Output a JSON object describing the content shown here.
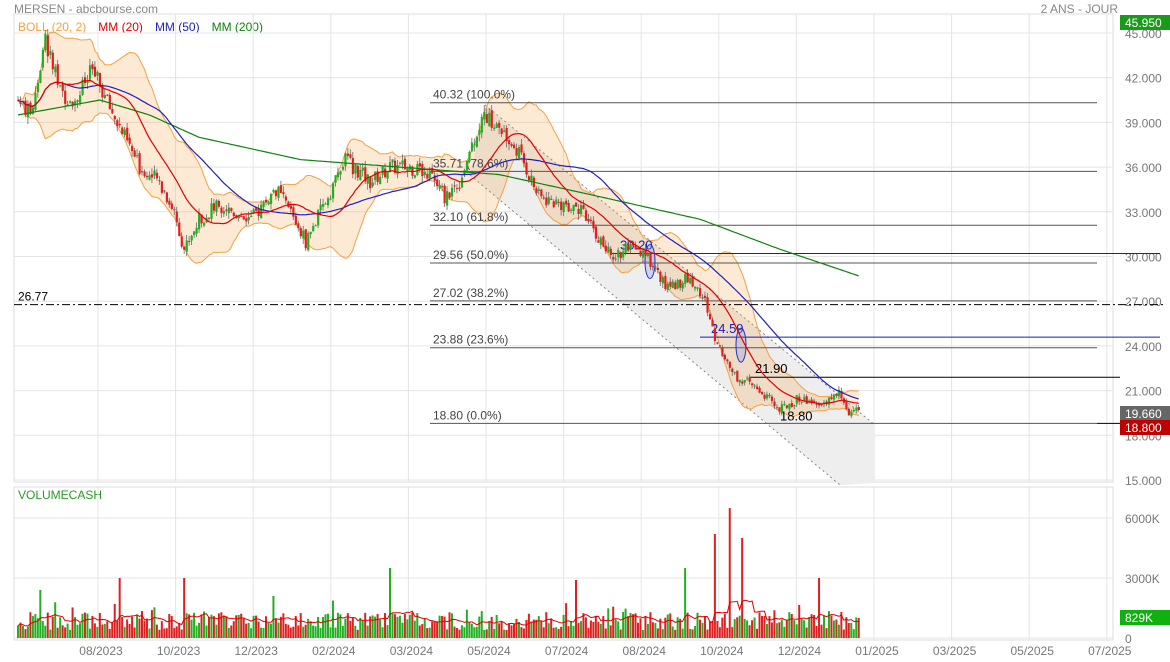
{
  "header": {
    "title": "MERSEN - abcbourse.com",
    "period": "2 ANS - JOUR"
  },
  "legend": [
    {
      "label": "BOLL (20, 2)",
      "color": "#f5a040"
    },
    {
      "label": "MM (20)",
      "color": "#e00000"
    },
    {
      "label": "MM (50)",
      "color": "#2020c0"
    },
    {
      "label": "MM (200)",
      "color": "#108010"
    }
  ],
  "volume_panel": {
    "title": "VOLUMECASH",
    "axis": [
      "6000K",
      "3000K",
      "0"
    ],
    "last_badge": "829K"
  },
  "price_axis": [
    "45.000",
    "42.000",
    "39.000",
    "36.000",
    "33.000",
    "30.000",
    "27.000",
    "24.000",
    "21.000",
    "18.000",
    "15.000"
  ],
  "badges": {
    "high": "45.950",
    "last": "19.660",
    "low": "18.800"
  },
  "x_axis": [
    "08/2023",
    "10/2023",
    "12/2023",
    "02/2024",
    "03/2024",
    "05/2024",
    "07/2024",
    "08/2024",
    "10/2024",
    "12/2024",
    "01/2025",
    "03/2025",
    "05/2025",
    "07/2025"
  ],
  "annotations": {
    "support_line": {
      "value": 26.77,
      "label": "26.77"
    },
    "fibonacci": [
      {
        "price": 40.32,
        "label": "40.32  (100.0%)"
      },
      {
        "price": 35.71,
        "label": "35.71  (78.6%)"
      },
      {
        "price": 32.1,
        "label": "32.10  (61.8%)"
      },
      {
        "price": 29.56,
        "label": "29.56  (50.0%)"
      },
      {
        "price": 27.02,
        "label": "27.02  (38.2%)"
      },
      {
        "price": 23.88,
        "label": "23.88  (23.6%)"
      },
      {
        "price": 18.8,
        "label": "18.80  (0.0%)"
      }
    ],
    "blue_levels": [
      {
        "price": 30.2,
        "label": "30.20"
      },
      {
        "price": 24.59,
        "label": "24.59"
      }
    ],
    "range_high": {
      "price": 21.9,
      "label": "21.90"
    },
    "range_low": {
      "price": 18.8,
      "label": "18.80"
    }
  },
  "chart_data": {
    "type": "candlestick",
    "ylim": [
      15,
      45
    ],
    "close_keypoints": [
      [
        0,
        40.5
      ],
      [
        5,
        39.5
      ],
      [
        11,
        44.5
      ],
      [
        17,
        41
      ],
      [
        23,
        40.5
      ],
      [
        30,
        42.5
      ],
      [
        37,
        40
      ],
      [
        43,
        38
      ],
      [
        49,
        36
      ],
      [
        57,
        35
      ],
      [
        63,
        33
      ],
      [
        67,
        30.5
      ],
      [
        73,
        32.5
      ],
      [
        81,
        33.5
      ],
      [
        94,
        32.5
      ],
      [
        104,
        34.5
      ],
      [
        110,
        33
      ],
      [
        116,
        31
      ],
      [
        122,
        33
      ],
      [
        132,
        36.5
      ],
      [
        142,
        35
      ],
      [
        150,
        36
      ],
      [
        158,
        36
      ],
      [
        166,
        35.5
      ],
      [
        172,
        34
      ],
      [
        178,
        35
      ],
      [
        184,
        38
      ],
      [
        188,
        39.5
      ],
      [
        194,
        38.5
      ],
      [
        202,
        37
      ],
      [
        210,
        34
      ],
      [
        219,
        33.5
      ],
      [
        225,
        33.5
      ],
      [
        231,
        32
      ],
      [
        239,
        30
      ],
      [
        247,
        30.5
      ],
      [
        255,
        29.7
      ],
      [
        261,
        28
      ],
      [
        271,
        28.5
      ],
      [
        277,
        27
      ],
      [
        281,
        24.5
      ],
      [
        289,
        22
      ],
      [
        299,
        21
      ],
      [
        307,
        19.7
      ],
      [
        315,
        20.5
      ],
      [
        323,
        20
      ],
      [
        331,
        20.8
      ],
      [
        335,
        19.5
      ],
      [
        339,
        19.66
      ]
    ],
    "ma200_keypoints": [
      [
        0,
        39.5
      ],
      [
        33,
        40.5
      ],
      [
        53,
        39.5
      ],
      [
        73,
        38
      ],
      [
        114,
        36.5
      ],
      [
        154,
        36
      ],
      [
        194,
        35.5
      ],
      [
        235,
        34
      ],
      [
        275,
        32.5
      ],
      [
        307,
        30.5
      ],
      [
        339,
        28.7
      ]
    ],
    "volume_spikes_k": [
      [
        9,
        2400
      ],
      [
        41,
        3000
      ],
      [
        67,
        3000
      ],
      [
        150,
        3500
      ],
      [
        225,
        2900
      ],
      [
        269,
        3500
      ],
      [
        281,
        5200
      ],
      [
        287,
        6500
      ],
      [
        292,
        5000
      ],
      [
        323,
        3000
      ]
    ]
  }
}
